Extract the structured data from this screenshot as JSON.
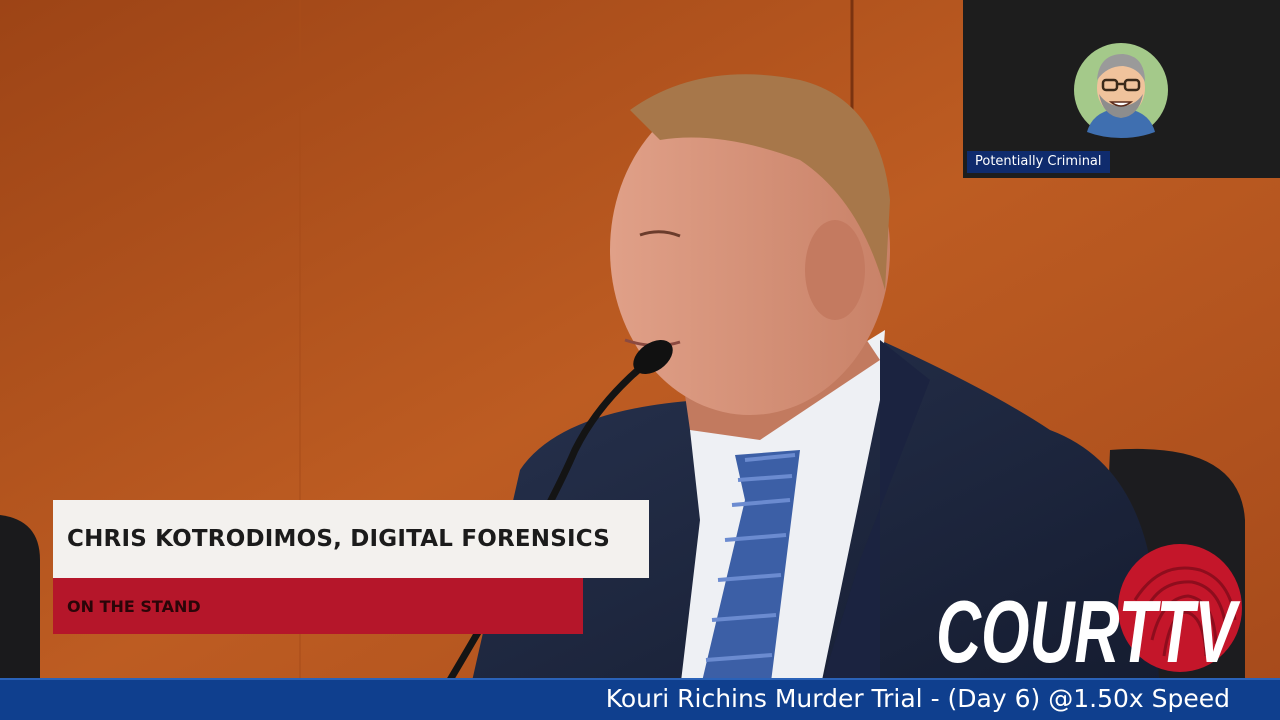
{
  "webcam": {
    "name_label": "Potentially Criminal",
    "avatar_icon": "cartoon-avatar-icon"
  },
  "lower_third": {
    "name": "CHRIS KOTRODIMOS, DIGITAL FORENSICS",
    "status": "ON THE STAND"
  },
  "logo": {
    "brand": "COURT TV",
    "icon": "fingerprint-icon"
  },
  "ticker": {
    "text": "Kouri Richins Murder Trial - (Day 6) @1.50x Speed"
  },
  "colors": {
    "wall": "#b2531f",
    "lower_third_bg": "#f3f1ee",
    "status_bar": "#b5162a",
    "ticker_bg": "#0f3f8e",
    "webcam_label_bg": "#0f2b6d",
    "logo_red": "#c4162a"
  }
}
